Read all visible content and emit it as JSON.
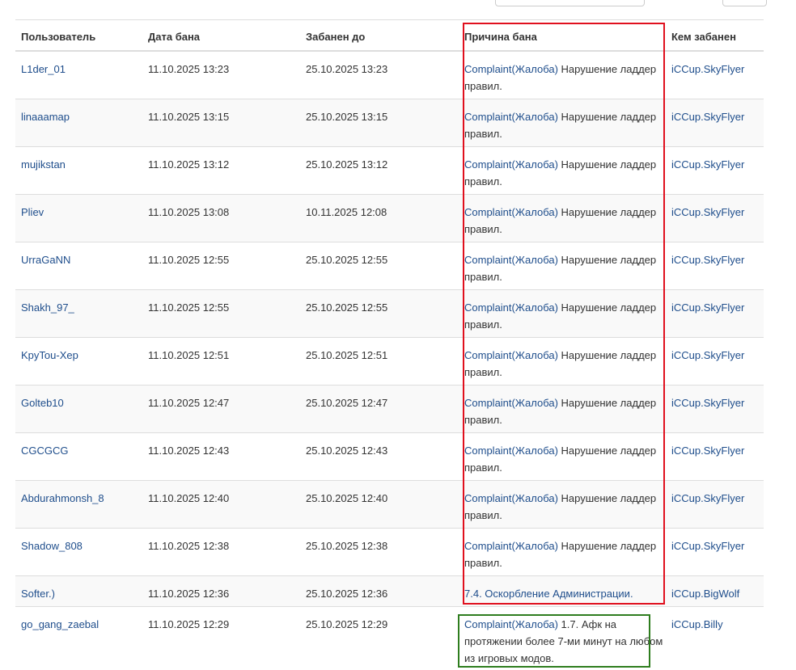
{
  "table": {
    "headers": {
      "user": "Пользователь",
      "ban_date": "Дата бана",
      "banned_until": "Забанен до",
      "reason": "Причина бана",
      "banned_by": "Кем забанен"
    },
    "rows": [
      {
        "user": "L1der_01",
        "ban_date": "11.10.2025 13:23",
        "banned_until": "25.10.2025 13:23",
        "reason_link": "Complaint(Жалоба)",
        "reason_text": " Нарушение ладдер правил.",
        "banned_by": "iCCup.SkyFlyer"
      },
      {
        "user": "linaaamap",
        "ban_date": "11.10.2025 13:15",
        "banned_until": "25.10.2025 13:15",
        "reason_link": "Complaint(Жалоба)",
        "reason_text": " Нарушение ладдер правил.",
        "banned_by": "iCCup.SkyFlyer"
      },
      {
        "user": "mujikstan",
        "ban_date": "11.10.2025 13:12",
        "banned_until": "25.10.2025 13:12",
        "reason_link": "Complaint(Жалоба)",
        "reason_text": " Нарушение ладдер правил.",
        "banned_by": "iCCup.SkyFlyer"
      },
      {
        "user": "Pliev",
        "ban_date": "11.10.2025 13:08",
        "banned_until": "10.11.2025 12:08",
        "reason_link": "Complaint(Жалоба)",
        "reason_text": " Нарушение ладдер правил.",
        "banned_by": "iCCup.SkyFlyer"
      },
      {
        "user": "UrraGaNN",
        "ban_date": "11.10.2025 12:55",
        "banned_until": "25.10.2025 12:55",
        "reason_link": "Complaint(Жалоба)",
        "reason_text": " Нарушение ладдер правил.",
        "banned_by": "iCCup.SkyFlyer"
      },
      {
        "user": "Shakh_97_",
        "ban_date": "11.10.2025 12:55",
        "banned_until": "25.10.2025 12:55",
        "reason_link": "Complaint(Жалоба)",
        "reason_text": " Нарушение ладдер правил.",
        "banned_by": "iCCup.SkyFlyer"
      },
      {
        "user": "KpyTou-Xep",
        "ban_date": "11.10.2025 12:51",
        "banned_until": "25.10.2025 12:51",
        "reason_link": "Complaint(Жалоба)",
        "reason_text": " Нарушение ладдер правил.",
        "banned_by": "iCCup.SkyFlyer"
      },
      {
        "user": "Golteb10",
        "ban_date": "11.10.2025 12:47",
        "banned_until": "25.10.2025 12:47",
        "reason_link": "Complaint(Жалоба)",
        "reason_text": " Нарушение ладдер правил.",
        "banned_by": "iCCup.SkyFlyer"
      },
      {
        "user": "CGCGCG",
        "ban_date": "11.10.2025 12:43",
        "banned_until": "25.10.2025 12:43",
        "reason_link": "Complaint(Жалоба)",
        "reason_text": " Нарушение ладдер правил.",
        "banned_by": "iCCup.SkyFlyer"
      },
      {
        "user": "Abdurahmonsh_8",
        "ban_date": "11.10.2025 12:40",
        "banned_until": "25.10.2025 12:40",
        "reason_link": "Complaint(Жалоба)",
        "reason_text": " Нарушение ладдер правил.",
        "banned_by": "iCCup.SkyFlyer"
      },
      {
        "user": "Shadow_808",
        "ban_date": "11.10.2025 12:38",
        "banned_until": "25.10.2025 12:38",
        "reason_link": "Complaint(Жалоба)",
        "reason_text": " Нарушение ладдер правил.",
        "banned_by": "iCCup.SkyFlyer"
      },
      {
        "user": "Softer.)",
        "ban_date": "11.10.2025 12:36",
        "banned_until": "25.10.2025 12:36",
        "reason_link": "7.4. Оскорбление Администрации.",
        "reason_text": "",
        "banned_by": "iCCup.BigWolf"
      },
      {
        "user": "go_gang_zaebal",
        "ban_date": "11.10.2025 12:29",
        "banned_until": "25.10.2025 12:29",
        "reason_link": "Complaint(Жалоба)",
        "reason_text": " 1.7. Афк на протяжении более 7-ми минут на любом из игровых модов.",
        "banned_by": "iCCup.Billy"
      }
    ]
  },
  "colors": {
    "link": "#1f4e8c",
    "highlight_red": "#e0101e",
    "highlight_green": "#2e7d1e"
  }
}
